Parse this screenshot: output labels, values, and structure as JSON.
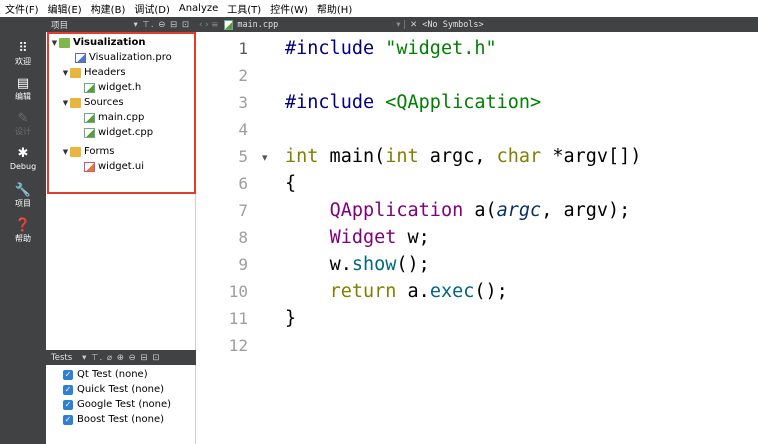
{
  "menu": [
    "文件(F)",
    "编辑(E)",
    "构建(B)",
    "调试(D)",
    "Analyze",
    "工具(T)",
    "控件(W)",
    "帮助(H)"
  ],
  "modes": [
    {
      "label": "欢迎",
      "icon": "grid-icon",
      "glyph": "⠿"
    },
    {
      "label": "编辑",
      "icon": "edit-document-icon",
      "glyph": "▤"
    },
    {
      "label": "设计",
      "icon": "pencil-icon",
      "glyph": "✎"
    },
    {
      "label": "Debug",
      "icon": "bug-icon",
      "glyph": "✱"
    },
    {
      "label": "项目",
      "icon": "wrench-icon",
      "glyph": "🔧"
    },
    {
      "label": "帮助",
      "icon": "help-icon",
      "glyph": "❓"
    }
  ],
  "project_panel": {
    "title": "项目",
    "tools": "▾ ⊤. ⊖ ⊟ ⊡",
    "tree": [
      {
        "label": "Visualization",
        "kind": "project"
      },
      {
        "label": "Visualization.pro",
        "kind": "pro-file"
      },
      {
        "label": "Headers",
        "kind": "folder"
      },
      {
        "label": "widget.h",
        "kind": "header-file"
      },
      {
        "label": "Sources",
        "kind": "folder"
      },
      {
        "label": "main.cpp",
        "kind": "cpp-file"
      },
      {
        "label": "widget.cpp",
        "kind": "cpp-file"
      },
      {
        "label": "Forms",
        "kind": "folder"
      },
      {
        "label": "widget.ui",
        "kind": "ui-file"
      }
    ]
  },
  "tests_panel": {
    "title": "Tests",
    "tools": "▾ ⊤. ⌀ ⊕ ⊖ ⊟ ⊡",
    "items": [
      "Qt Test (none)",
      "Quick Test (none)",
      "Google Test (none)",
      "Boost Test (none)"
    ]
  },
  "editor_toolbar": {
    "nav": "‹ › ≡",
    "file": "main.cpp",
    "symbol_sep": "▾ |",
    "close": "✕",
    "symbols": "<No Symbols>"
  },
  "editor": {
    "current_line": 1,
    "line_numbers": [
      "1",
      "2",
      "3",
      "4",
      "5",
      "6",
      "7",
      "8",
      "9",
      "10",
      "11",
      "12"
    ],
    "fold_marker": "▾",
    "code": {
      "l1_directive": "#include",
      "l1_file": "\"widget.h\"",
      "l3_directive": "#include",
      "l3_file": "<QApplication>",
      "l5_int": "int",
      "l5_main": " main(",
      "l5_int2": "int",
      "l5_argc": " argc, ",
      "l5_char": "char",
      "l5_rest": " *argv[])",
      "l6": "{",
      "l7_type": "QApplication",
      "l7_a": " a(",
      "l7_argc": "argc",
      "l7_rest": ", argv);",
      "l8_type": "Widget",
      "l8_rest": " w;",
      "l9_w": "w.",
      "l9_show": "show",
      "l9_rest": "();",
      "l10_return": "return",
      "l10_a": " a.",
      "l10_exec": "exec",
      "l10_rest": "();",
      "l11": "}"
    }
  },
  "colors": {
    "highlight_border": "#e53b2b",
    "sidebar_bg": "#404244",
    "keyword": "#808000",
    "string": "#008000",
    "type": "#800080",
    "checkbox": "#2f7fd6"
  }
}
